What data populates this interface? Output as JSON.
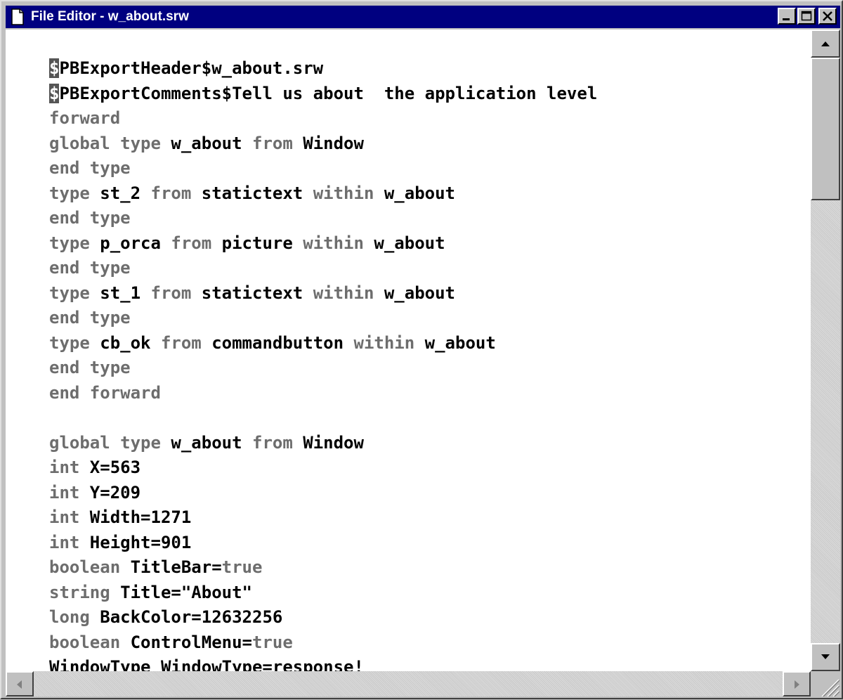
{
  "window": {
    "title": "File Editor - w_about.srw",
    "icon": "document-icon"
  },
  "controls": {
    "minimize": "minimize-icon",
    "maximize": "maximize-icon",
    "close": "close-icon"
  },
  "editor": {
    "lines": [
      [
        {
          "t": "$",
          "c": "cursor-mark"
        },
        {
          "t": "PBExportHeader$w_about.srw"
        }
      ],
      [
        {
          "t": "$",
          "c": "cursor-mark"
        },
        {
          "t": "PBExportComments$Tell us about  the application level"
        }
      ],
      [
        {
          "t": "forward",
          "c": "kw"
        }
      ],
      [
        {
          "t": "global type ",
          "c": "kw"
        },
        {
          "t": "w_about"
        },
        {
          "t": " from ",
          "c": "kw"
        },
        {
          "t": "Window"
        }
      ],
      [
        {
          "t": "end type",
          "c": "kw"
        }
      ],
      [
        {
          "t": "type ",
          "c": "kw"
        },
        {
          "t": "st_2"
        },
        {
          "t": " from ",
          "c": "kw"
        },
        {
          "t": "statictext"
        },
        {
          "t": " within ",
          "c": "kw"
        },
        {
          "t": "w_about"
        }
      ],
      [
        {
          "t": "end type",
          "c": "kw"
        }
      ],
      [
        {
          "t": "type ",
          "c": "kw"
        },
        {
          "t": "p_orca"
        },
        {
          "t": " from ",
          "c": "kw"
        },
        {
          "t": "picture"
        },
        {
          "t": " within ",
          "c": "kw"
        },
        {
          "t": "w_about"
        }
      ],
      [
        {
          "t": "end type",
          "c": "kw"
        }
      ],
      [
        {
          "t": "type ",
          "c": "kw"
        },
        {
          "t": "st_1"
        },
        {
          "t": " from ",
          "c": "kw"
        },
        {
          "t": "statictext"
        },
        {
          "t": " within ",
          "c": "kw"
        },
        {
          "t": "w_about"
        }
      ],
      [
        {
          "t": "end type",
          "c": "kw"
        }
      ],
      [
        {
          "t": "type ",
          "c": "kw"
        },
        {
          "t": "cb_ok"
        },
        {
          "t": " from ",
          "c": "kw"
        },
        {
          "t": "commandbutton"
        },
        {
          "t": " within ",
          "c": "kw"
        },
        {
          "t": "w_about"
        }
      ],
      [
        {
          "t": "end type",
          "c": "kw"
        }
      ],
      [
        {
          "t": "end forward",
          "c": "kw"
        }
      ],
      [],
      [
        {
          "t": "global type ",
          "c": "kw"
        },
        {
          "t": "w_about"
        },
        {
          "t": " from ",
          "c": "kw"
        },
        {
          "t": "Window"
        }
      ],
      [
        {
          "t": "int ",
          "c": "kw"
        },
        {
          "t": "X=563"
        }
      ],
      [
        {
          "t": "int ",
          "c": "kw"
        },
        {
          "t": "Y=209"
        }
      ],
      [
        {
          "t": "int ",
          "c": "kw"
        },
        {
          "t": "Width=1271"
        }
      ],
      [
        {
          "t": "int ",
          "c": "kw"
        },
        {
          "t": "Height=901"
        }
      ],
      [
        {
          "t": "boolean ",
          "c": "kw"
        },
        {
          "t": "TitleBar="
        },
        {
          "t": "true",
          "c": "kw"
        }
      ],
      [
        {
          "t": "string ",
          "c": "kw"
        },
        {
          "t": "Title=\"About\""
        }
      ],
      [
        {
          "t": "long ",
          "c": "kw"
        },
        {
          "t": "BackColor=12632256"
        }
      ],
      [
        {
          "t": "boolean ",
          "c": "kw"
        },
        {
          "t": "ControlMenu="
        },
        {
          "t": "true",
          "c": "kw"
        }
      ],
      [
        {
          "t": "WindowType WindowType=response!"
        }
      ]
    ]
  },
  "scrollbars": {
    "vertical_position": 0.0,
    "up_icon": "arrow-up-icon",
    "down_icon": "arrow-down-icon",
    "left_icon": "arrow-left-icon",
    "right_icon": "arrow-right-icon",
    "grip_icon": "resize-grip-icon"
  }
}
